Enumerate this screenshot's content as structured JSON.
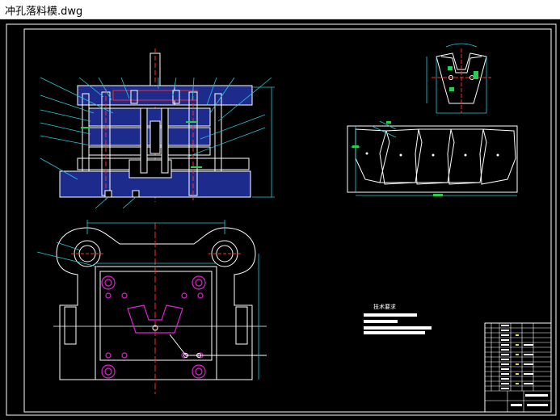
{
  "window": {
    "title": "冲孔落料模.dwg"
  },
  "drawing": {
    "tech_title": "技术要求",
    "colors": {
      "background": "#000000",
      "frame": "#ffffff",
      "blue_fill": "#1d2c8c",
      "red": "#ff2a2a",
      "cyan": "#28c8d8",
      "green": "#22d24a",
      "magenta": "#e020d0",
      "yellow": "#f0e040"
    }
  }
}
